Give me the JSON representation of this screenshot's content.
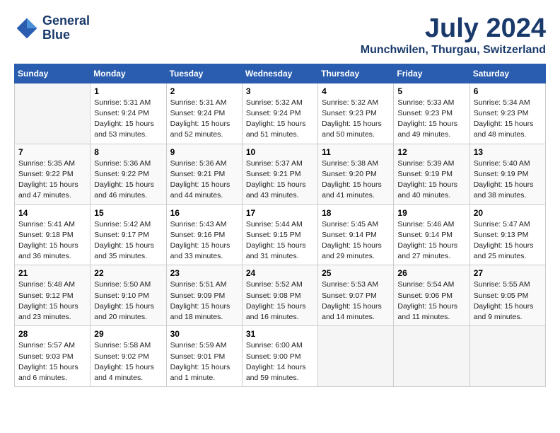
{
  "header": {
    "logo_line1": "General",
    "logo_line2": "Blue",
    "month": "July 2024",
    "location": "Munchwilen, Thurgau, Switzerland"
  },
  "columns": [
    "Sunday",
    "Monday",
    "Tuesday",
    "Wednesday",
    "Thursday",
    "Friday",
    "Saturday"
  ],
  "weeks": [
    [
      {
        "day": "",
        "info": ""
      },
      {
        "day": "1",
        "info": "Sunrise: 5:31 AM\nSunset: 9:24 PM\nDaylight: 15 hours\nand 53 minutes."
      },
      {
        "day": "2",
        "info": "Sunrise: 5:31 AM\nSunset: 9:24 PM\nDaylight: 15 hours\nand 52 minutes."
      },
      {
        "day": "3",
        "info": "Sunrise: 5:32 AM\nSunset: 9:24 PM\nDaylight: 15 hours\nand 51 minutes."
      },
      {
        "day": "4",
        "info": "Sunrise: 5:32 AM\nSunset: 9:23 PM\nDaylight: 15 hours\nand 50 minutes."
      },
      {
        "day": "5",
        "info": "Sunrise: 5:33 AM\nSunset: 9:23 PM\nDaylight: 15 hours\nand 49 minutes."
      },
      {
        "day": "6",
        "info": "Sunrise: 5:34 AM\nSunset: 9:23 PM\nDaylight: 15 hours\nand 48 minutes."
      }
    ],
    [
      {
        "day": "7",
        "info": "Sunrise: 5:35 AM\nSunset: 9:22 PM\nDaylight: 15 hours\nand 47 minutes."
      },
      {
        "day": "8",
        "info": "Sunrise: 5:36 AM\nSunset: 9:22 PM\nDaylight: 15 hours\nand 46 minutes."
      },
      {
        "day": "9",
        "info": "Sunrise: 5:36 AM\nSunset: 9:21 PM\nDaylight: 15 hours\nand 44 minutes."
      },
      {
        "day": "10",
        "info": "Sunrise: 5:37 AM\nSunset: 9:21 PM\nDaylight: 15 hours\nand 43 minutes."
      },
      {
        "day": "11",
        "info": "Sunrise: 5:38 AM\nSunset: 9:20 PM\nDaylight: 15 hours\nand 41 minutes."
      },
      {
        "day": "12",
        "info": "Sunrise: 5:39 AM\nSunset: 9:19 PM\nDaylight: 15 hours\nand 40 minutes."
      },
      {
        "day": "13",
        "info": "Sunrise: 5:40 AM\nSunset: 9:19 PM\nDaylight: 15 hours\nand 38 minutes."
      }
    ],
    [
      {
        "day": "14",
        "info": "Sunrise: 5:41 AM\nSunset: 9:18 PM\nDaylight: 15 hours\nand 36 minutes."
      },
      {
        "day": "15",
        "info": "Sunrise: 5:42 AM\nSunset: 9:17 PM\nDaylight: 15 hours\nand 35 minutes."
      },
      {
        "day": "16",
        "info": "Sunrise: 5:43 AM\nSunset: 9:16 PM\nDaylight: 15 hours\nand 33 minutes."
      },
      {
        "day": "17",
        "info": "Sunrise: 5:44 AM\nSunset: 9:15 PM\nDaylight: 15 hours\nand 31 minutes."
      },
      {
        "day": "18",
        "info": "Sunrise: 5:45 AM\nSunset: 9:14 PM\nDaylight: 15 hours\nand 29 minutes."
      },
      {
        "day": "19",
        "info": "Sunrise: 5:46 AM\nSunset: 9:14 PM\nDaylight: 15 hours\nand 27 minutes."
      },
      {
        "day": "20",
        "info": "Sunrise: 5:47 AM\nSunset: 9:13 PM\nDaylight: 15 hours\nand 25 minutes."
      }
    ],
    [
      {
        "day": "21",
        "info": "Sunrise: 5:48 AM\nSunset: 9:12 PM\nDaylight: 15 hours\nand 23 minutes."
      },
      {
        "day": "22",
        "info": "Sunrise: 5:50 AM\nSunset: 9:10 PM\nDaylight: 15 hours\nand 20 minutes."
      },
      {
        "day": "23",
        "info": "Sunrise: 5:51 AM\nSunset: 9:09 PM\nDaylight: 15 hours\nand 18 minutes."
      },
      {
        "day": "24",
        "info": "Sunrise: 5:52 AM\nSunset: 9:08 PM\nDaylight: 15 hours\nand 16 minutes."
      },
      {
        "day": "25",
        "info": "Sunrise: 5:53 AM\nSunset: 9:07 PM\nDaylight: 15 hours\nand 14 minutes."
      },
      {
        "day": "26",
        "info": "Sunrise: 5:54 AM\nSunset: 9:06 PM\nDaylight: 15 hours\nand 11 minutes."
      },
      {
        "day": "27",
        "info": "Sunrise: 5:55 AM\nSunset: 9:05 PM\nDaylight: 15 hours\nand 9 minutes."
      }
    ],
    [
      {
        "day": "28",
        "info": "Sunrise: 5:57 AM\nSunset: 9:03 PM\nDaylight: 15 hours\nand 6 minutes."
      },
      {
        "day": "29",
        "info": "Sunrise: 5:58 AM\nSunset: 9:02 PM\nDaylight: 15 hours\nand 4 minutes."
      },
      {
        "day": "30",
        "info": "Sunrise: 5:59 AM\nSunset: 9:01 PM\nDaylight: 15 hours\nand 1 minute."
      },
      {
        "day": "31",
        "info": "Sunrise: 6:00 AM\nSunset: 9:00 PM\nDaylight: 14 hours\nand 59 minutes."
      },
      {
        "day": "",
        "info": ""
      },
      {
        "day": "",
        "info": ""
      },
      {
        "day": "",
        "info": ""
      }
    ]
  ]
}
